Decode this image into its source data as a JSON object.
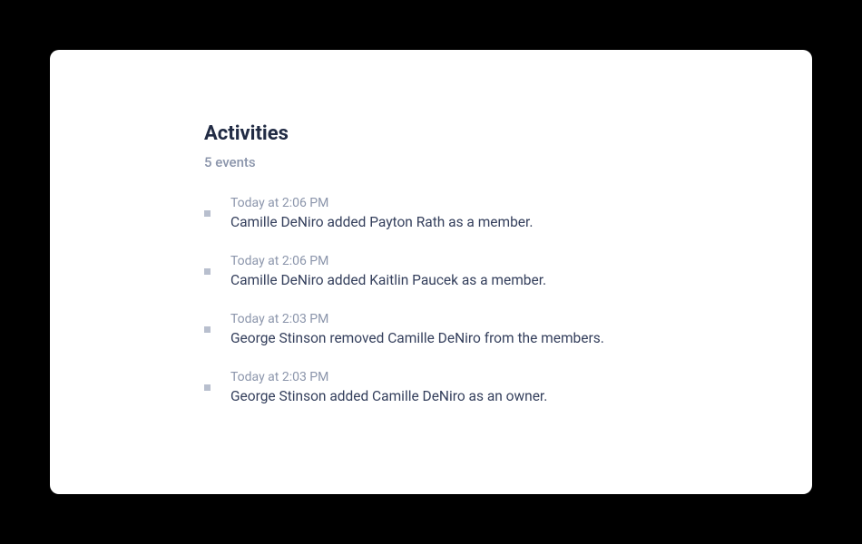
{
  "header": {
    "title": "Activities",
    "subtitle": "5 events"
  },
  "activities": [
    {
      "time": "Today at 2:06 PM",
      "text": "Camille DeNiro added Payton Rath as a member."
    },
    {
      "time": "Today at 2:06 PM",
      "text": "Camille DeNiro added Kaitlin Paucek as a member."
    },
    {
      "time": "Today at 2:03 PM",
      "text": "George Stinson removed Camille DeNiro from the members."
    },
    {
      "time": "Today at 2:03 PM",
      "text": "George Stinson added Camille DeNiro as an owner."
    }
  ]
}
